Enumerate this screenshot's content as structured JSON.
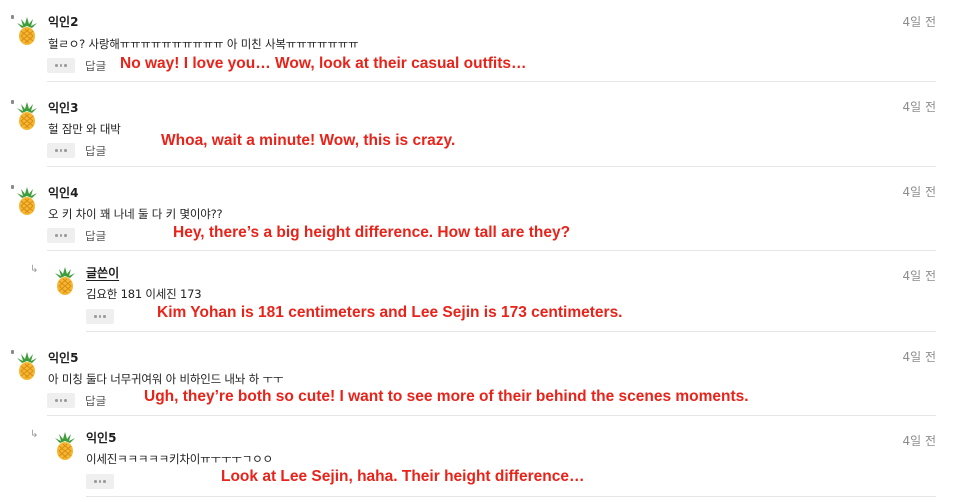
{
  "colors": {
    "translation": "#e8231a",
    "timestamp": "#8d8d8d",
    "separator": "#e6e6e6"
  },
  "comments": [
    {
      "author": "익인2",
      "time": "4일 전",
      "text": "헐ㄹㅇ? 사랑해ㅠㅠㅠㅠㅠㅠㅠㅠㅠㅠ 아 미친 사복ㅠㅠㅠㅠㅠㅠㅠ",
      "reply_label": "답글",
      "translation": "No way! I love you… Wow, look at their casual outfits…"
    },
    {
      "author": "익인3",
      "time": "4일 전",
      "text": "헐 잠만 와 대박",
      "reply_label": "답글",
      "translation": "Whoa, wait a minute! Wow, this is crazy."
    },
    {
      "author": "익인4",
      "time": "4일 전",
      "text": "오 키 차이 꽤 나네 둘 다 키 몇이야??",
      "reply_label": "답글",
      "translation": "Hey, there’s a big height difference. How tall are they?"
    },
    {
      "author": "글쓴이",
      "time": "4일 전",
      "text": "김요한 181 이세진 173",
      "translation": "Kim Yohan is 181 centimeters and Lee Sejin is 173 centimeters."
    },
    {
      "author": "익인5",
      "time": "4일 전",
      "text": "아 미칭 둘다 너무귀여워 아 비하인드 내놔 하 ㅜㅜ",
      "reply_label": "답글",
      "translation": "Ugh, they’re both so cute! I want to see more of their behind the scenes moments."
    },
    {
      "author": "익인5",
      "time": "4일 전",
      "text": "이세진ㅋㅋㅋㅋㅋ키차이ㅠㅜㅜㅜㄱㅇㅇ",
      "translation": "Look at Lee Sejin, haha. Their height difference…"
    }
  ]
}
